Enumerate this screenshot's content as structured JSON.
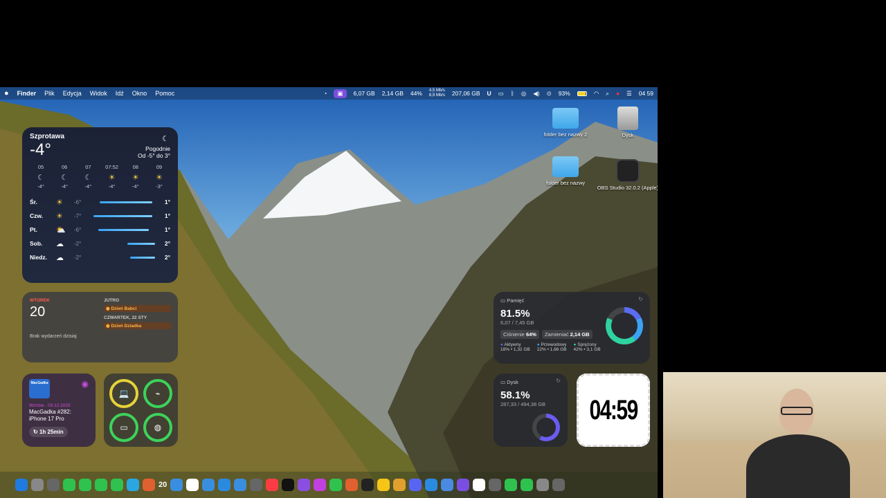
{
  "menubar": {
    "app_name": "Finder",
    "menus": [
      "Plik",
      "Edycja",
      "Widok",
      "Idź",
      "Okno",
      "Pomoc"
    ],
    "mem_used": "6,07 GB",
    "swap": "2,14 GB",
    "cpu": "44%",
    "net_up": "4,5 Mb/s",
    "net_down": "8,9 Mb/s",
    "disk_free": "207,06 GB",
    "battery": "93%",
    "time": "04 59"
  },
  "weather": {
    "city": "Szprotawa",
    "temp": "-4°",
    "condition": "Pogodnie",
    "range": "Od -5° do 3°",
    "hours": [
      {
        "time": "05",
        "icon": "moon",
        "temp": "-4°"
      },
      {
        "time": "06",
        "icon": "moon",
        "temp": "-4°"
      },
      {
        "time": "07",
        "icon": "moon",
        "temp": "-4°"
      },
      {
        "time": "07:52",
        "icon": "sunrise",
        "temp": "-4°"
      },
      {
        "time": "08",
        "icon": "sun",
        "temp": "-4°"
      },
      {
        "time": "09",
        "icon": "sun",
        "temp": "-3°"
      }
    ],
    "days": [
      {
        "name": "Śr.",
        "icon": "sun",
        "lo": "-6°",
        "hi": "1°",
        "bar_start": 0.1,
        "bar_end": 0.95
      },
      {
        "name": "Czw.",
        "icon": "sun",
        "lo": "-7°",
        "hi": "1°",
        "bar_start": 0.0,
        "bar_end": 0.95
      },
      {
        "name": "Pt.",
        "icon": "partly-cloudy",
        "lo": "-6°",
        "hi": "1°",
        "bar_start": 0.08,
        "bar_end": 0.9
      },
      {
        "name": "Sob.",
        "icon": "cloud",
        "lo": "-2°",
        "hi": "2°",
        "bar_start": 0.55,
        "bar_end": 1.0
      },
      {
        "name": "Niedz.",
        "icon": "cloud",
        "lo": "-2°",
        "hi": "2°",
        "bar_start": 0.6,
        "bar_end": 1.0
      }
    ]
  },
  "calendar": {
    "dow": "WTOREK",
    "day": "20",
    "no_events": "Brak wydarzeń dzisiaj",
    "tomorrow_label": "JUTRO",
    "tomorrow_event": "Dzień Babci",
    "next_label": "CZWARTEK, 22 STY",
    "next_event": "Dzień Dziadka"
  },
  "podcast": {
    "date": "Wznów · 03.12.2025",
    "title": "MacGadka #282: iPhone 17 Pro",
    "duration": "1h 25min",
    "art_label": "MacGadka"
  },
  "memory": {
    "header": "Pamięć",
    "percent": "81.5%",
    "used": "6,07 / 7,45 GB",
    "pressure_label": "Ciśnienie",
    "pressure_value": "64%",
    "swap_label": "Zamieniać",
    "swap_value": "2,14 GB",
    "legend": [
      {
        "name": "Aktywny",
        "value": "18% • 1,32 GB",
        "color": "#5a6cf0"
      },
      {
        "name": "Przewodowy",
        "value": "22% • 1,66 GB",
        "color": "#3aa3f4"
      },
      {
        "name": "Sprężony",
        "value": "42% • 3,1 GB",
        "color": "#2fd3a0"
      }
    ]
  },
  "disk": {
    "header": "Dysk",
    "percent": "58.1%",
    "used": "287,33 / 494,38 GB"
  },
  "clock": {
    "time": "04:59"
  },
  "desktop_icons": [
    {
      "label": "folder bez nazwy 2",
      "type": "folder"
    },
    {
      "label": "Dysk",
      "type": "hdd"
    },
    {
      "label": "folder bez nazwy",
      "type": "folder"
    },
    {
      "label": "OBS Studio 32.0.2 (Apple)",
      "type": "obs"
    }
  ],
  "dock": {
    "calendar_day": "20",
    "app_colors": [
      "#1f7be0",
      "#888",
      "#666",
      "#2fc24f",
      "#2fc24f",
      "#2fc24f",
      "#2fc24f",
      "#2aa7e0",
      "#e06030",
      "#3a8ee0",
      "#ffffff",
      "#3a8ee0",
      "#2a8ae0",
      "#3a8ee0",
      "#666",
      "#fc3c44",
      "#111",
      "#8a4ee0",
      "#c040e0",
      "#2fc24f",
      "#e06030",
      "#222",
      "#f5c518",
      "#e0a030",
      "#5865f2",
      "#2a8ae0",
      "#4a8ae0",
      "#7a4ee0",
      "#fff",
      "#666",
      "#2fc24f",
      "#2fc24f",
      "#888",
      "#666"
    ]
  }
}
